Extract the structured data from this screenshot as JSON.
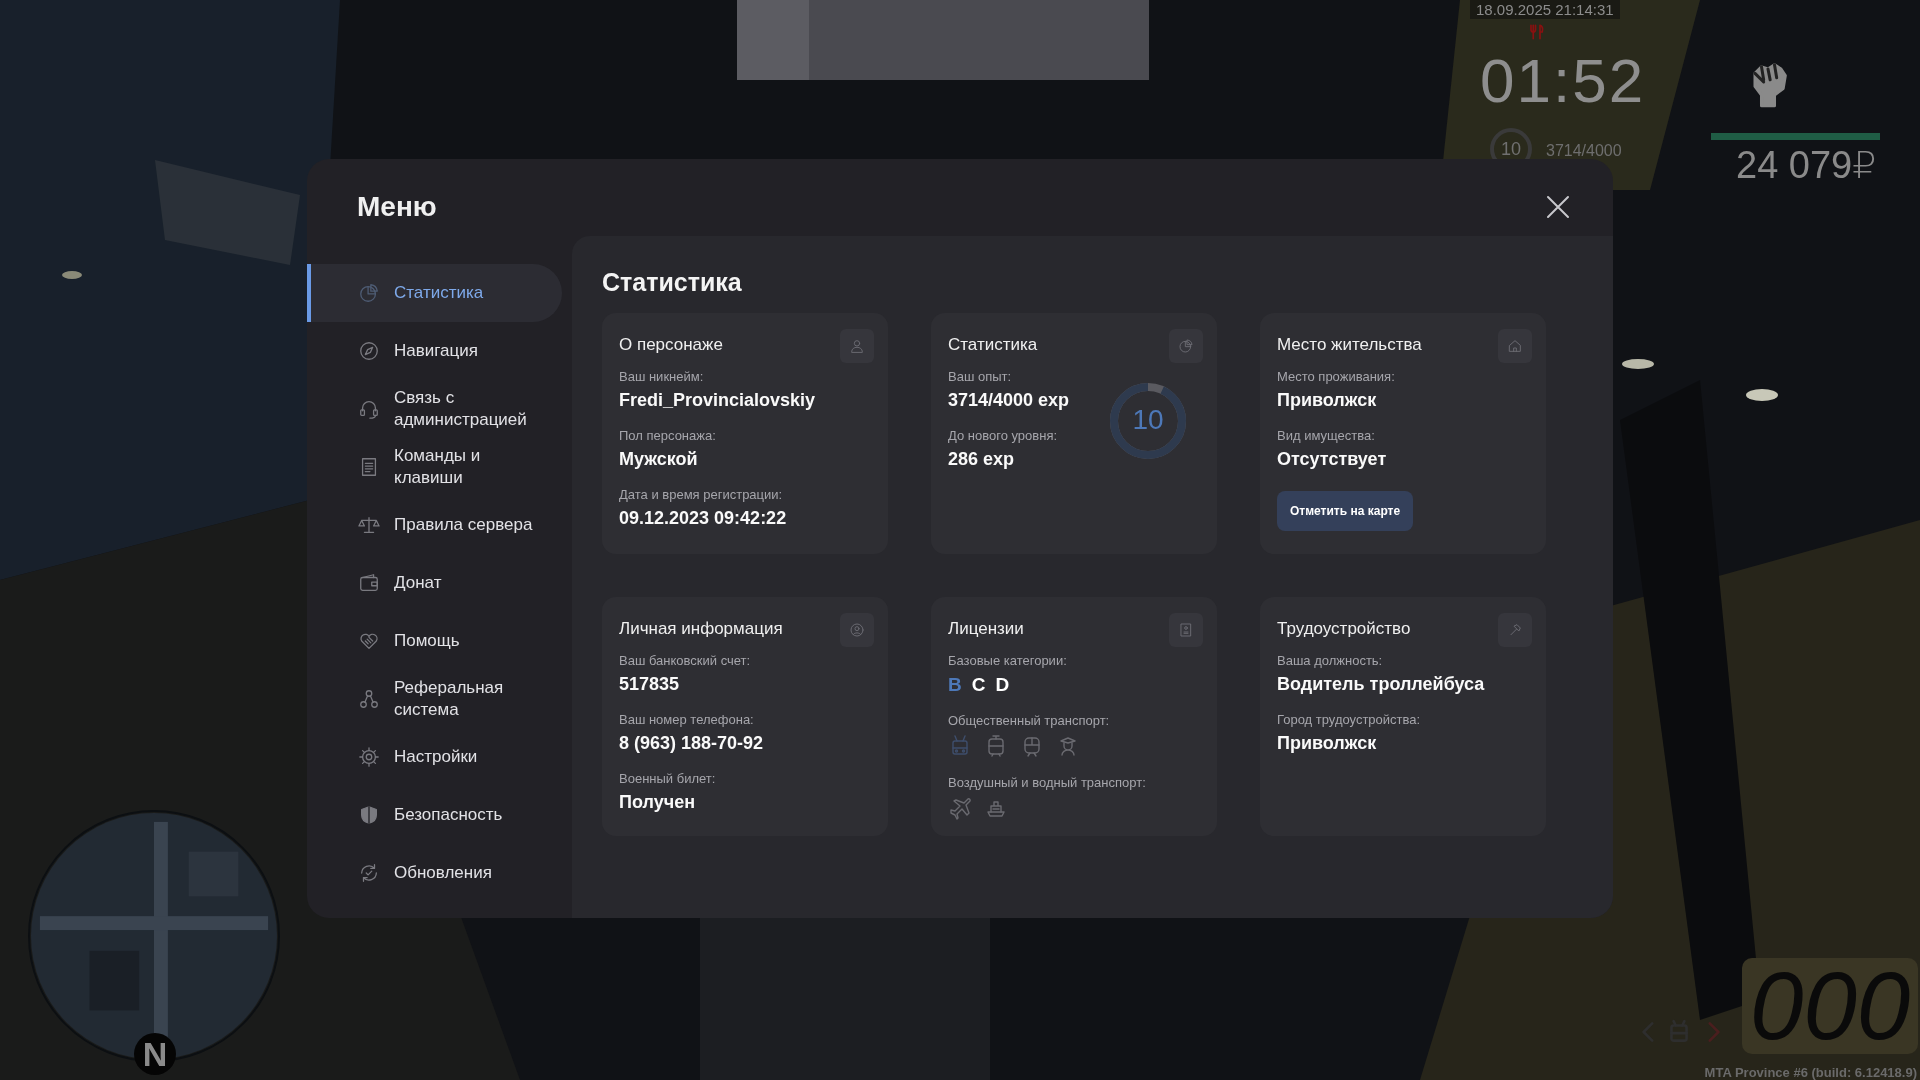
{
  "hud": {
    "datetime": "18.09.2025 21:14:31",
    "clock": "01:52",
    "level_number": "10",
    "experience": "3714/4000",
    "health": {
      "level": 1
    },
    "money": "24 079₽",
    "speed": "000",
    "build_info": "MTA Province #6 (build: 6.12418.9)"
  },
  "minimap": {
    "compass": "N"
  },
  "menu": {
    "title": "Меню",
    "items": [
      {
        "label": "Статистика",
        "selected": true
      },
      {
        "label": "Навигация",
        "selected": false
      },
      {
        "label": "Связь с администрацией",
        "selected": false
      },
      {
        "label": "Команды и клавиши",
        "selected": false
      },
      {
        "label": "Правила сервера",
        "selected": false
      },
      {
        "label": "Донат",
        "selected": false
      },
      {
        "label": "Помощь",
        "selected": false
      },
      {
        "label": "Реферальная система",
        "selected": false
      },
      {
        "label": "Настройки",
        "selected": false
      },
      {
        "label": "Безопасность",
        "selected": false
      },
      {
        "label": "Обновления",
        "selected": false
      }
    ],
    "section_title": "Статистика",
    "cards": [
      {
        "title": "О персонаже",
        "fields": [
          {
            "label": "Ваш никнейм:",
            "value": "Fredi_Provincialovskiy"
          },
          {
            "label": "Пол персонажа:",
            "value": "Мужской"
          },
          {
            "label": "Дата и время регистрации:",
            "value": "09.12.2023 09:42:22"
          }
        ]
      },
      {
        "title": "Статистика",
        "fields": [
          {
            "label": "Ваш опыт:",
            "value": "3714/4000 exp"
          },
          {
            "label": "До нового уровня:",
            "value": "286 exp"
          }
        ],
        "ring": {
          "label": "10",
          "level": 0.93
        }
      },
      {
        "title": "Место жительства",
        "fields": [
          {
            "label": "Место проживания:",
            "value": "Приволжск"
          },
          {
            "label": "Вид имущества:",
            "value": "Отсутствует"
          }
        ],
        "button": "Отметить на карте"
      },
      {
        "title": "Личная информация",
        "fields": [
          {
            "label": "Ваш банковский счет:",
            "value": "517835"
          },
          {
            "label": "Ваш номер телефона:",
            "value": "8 (963) 188-70-92"
          },
          {
            "label": "Военный билет:",
            "value": "Получен"
          }
        ]
      },
      {
        "title": "Лицензии",
        "categories_label": "Базовые категории:",
        "categories": [
          {
            "text": "B",
            "active": true
          },
          {
            "text": "C",
            "active": false
          },
          {
            "text": "D",
            "active": false
          }
        ],
        "groups": [
          {
            "label": "Общественный транспорт:",
            "vehicles": [
              {
                "active": true
              },
              {
                "active": false
              },
              {
                "active": false
              },
              {
                "active": false
              }
            ]
          },
          {
            "label": "Воздушный и водный транспорт:",
            "vehicles": [
              {
                "active": false
              },
              {
                "active": false
              }
            ]
          }
        ]
      },
      {
        "title": "Трудоустройство",
        "fields": [
          {
            "label": "Ваша должность:",
            "value": "Водитель троллейбуса"
          },
          {
            "label": "Город трудоустройства:",
            "value": "Приволжск"
          }
        ]
      }
    ]
  }
}
